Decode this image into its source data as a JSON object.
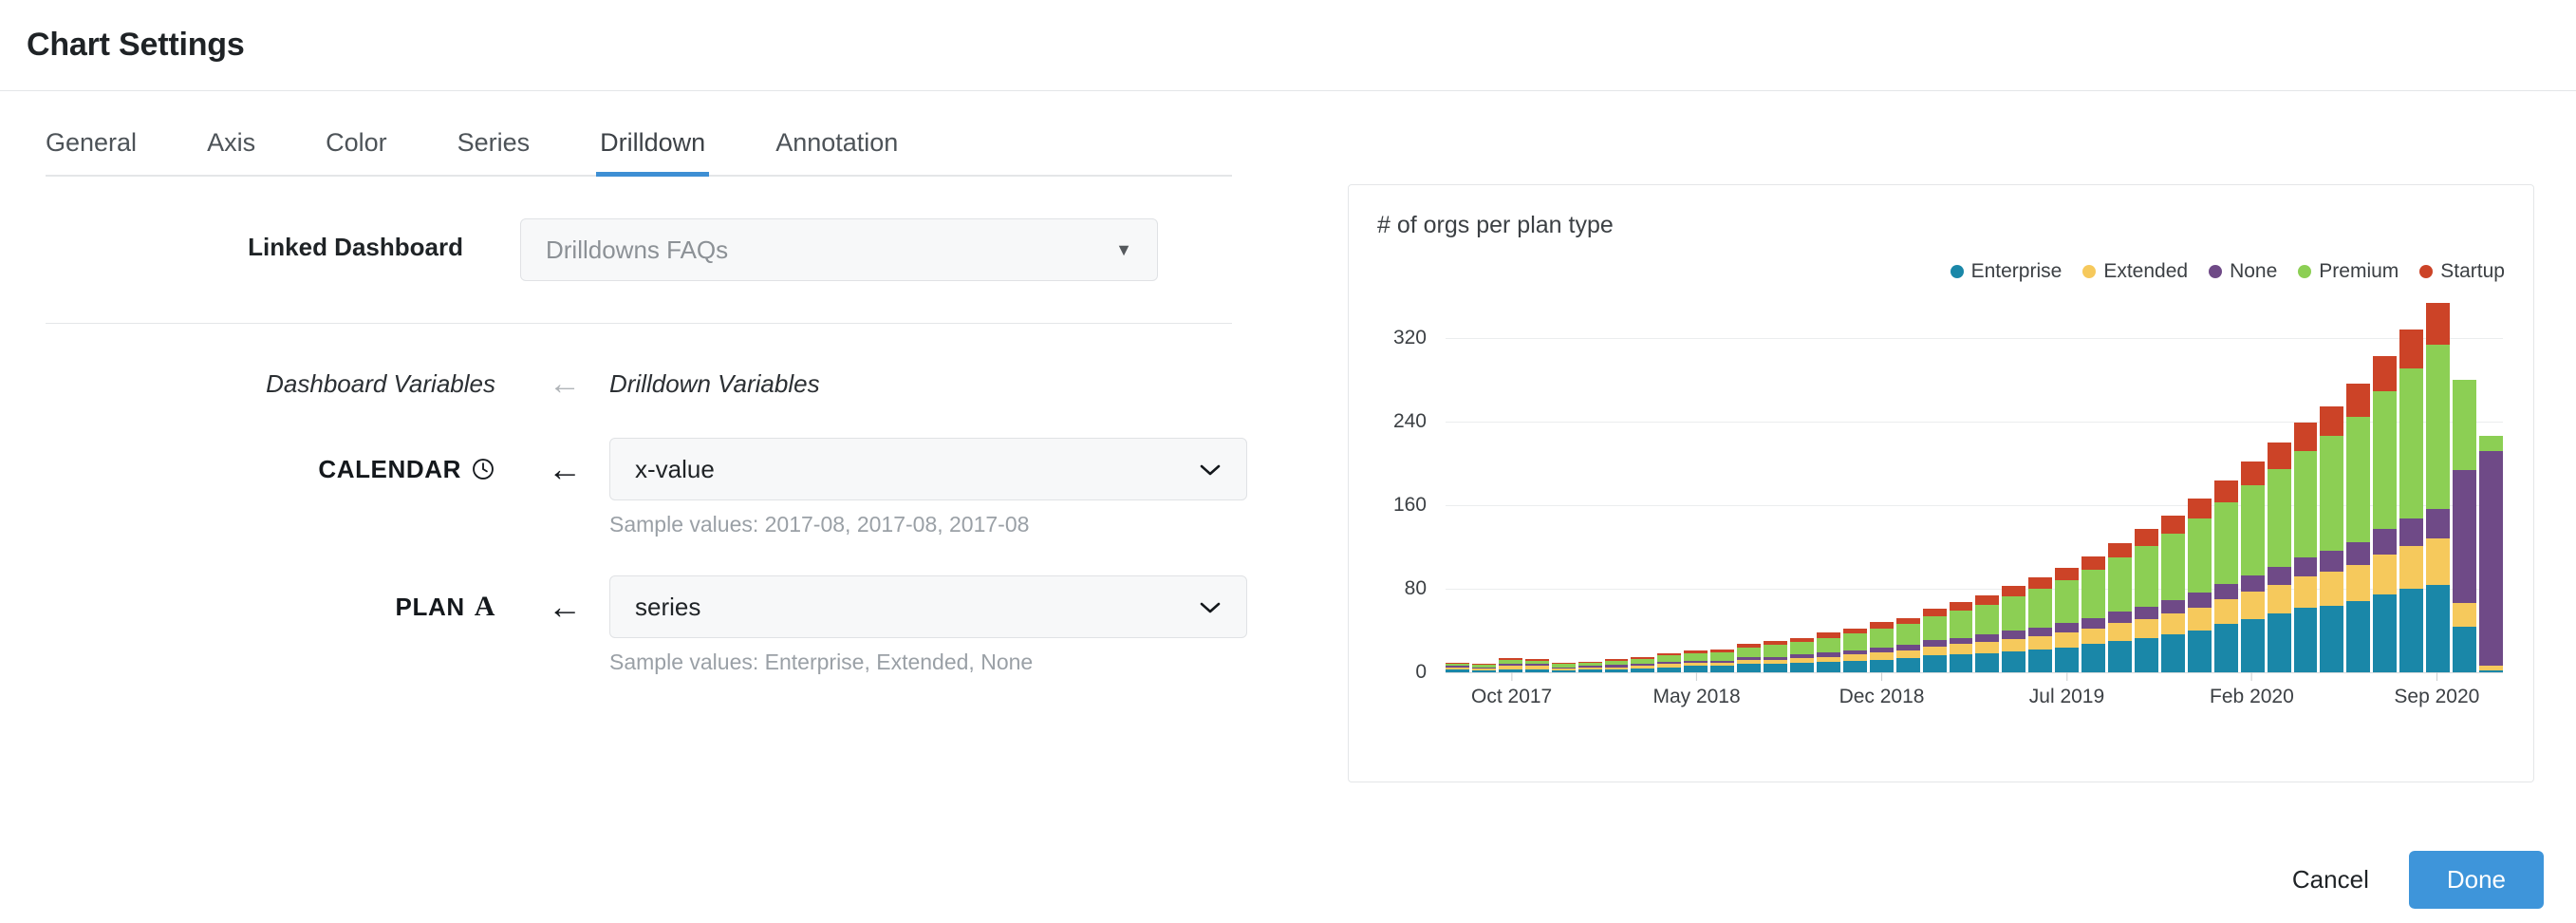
{
  "header": {
    "title": "Chart Settings"
  },
  "tabs": [
    {
      "label": "General",
      "active": false
    },
    {
      "label": "Axis",
      "active": false
    },
    {
      "label": "Color",
      "active": false
    },
    {
      "label": "Series",
      "active": false
    },
    {
      "label": "Drilldown",
      "active": true
    },
    {
      "label": "Annotation",
      "active": false
    }
  ],
  "linked_dashboard": {
    "label": "Linked Dashboard",
    "value": "Drilldowns FAQs",
    "caret": "▼"
  },
  "variables": {
    "left_heading": "Dashboard Variables",
    "right_heading": "Drilldown Variables",
    "head_arrow": "←",
    "rows": [
      {
        "name": "CALENDAR",
        "type_icon": "clock-icon",
        "arrow": "←",
        "value": "x-value",
        "sample": "Sample values: 2017-08, 2017-08, 2017-08",
        "caret": "⌄"
      },
      {
        "name": "PLAN",
        "type_icon": "text-type-icon",
        "type_glyph": "A",
        "arrow": "←",
        "value": "series",
        "sample": "Sample values: Enterprise, Extended, None",
        "caret": "⌄"
      }
    ]
  },
  "footer": {
    "cancel_label": "Cancel",
    "done_label": "Done",
    "done_color": "#3e95da"
  },
  "chart_data": {
    "type": "bar",
    "stacked": true,
    "title": "# of orgs per plan type",
    "xlabel": "",
    "ylabel": "",
    "ylim": [
      0,
      360
    ],
    "yticks": [
      0,
      80,
      160,
      240,
      320
    ],
    "grid": true,
    "legend_position": "top-right",
    "colors": {
      "Enterprise": "#1a87a8",
      "Extended": "#f6c95c",
      "None": "#6f4a87",
      "Premium": "#8ccf54",
      "Startup": "#cc4327"
    },
    "legend": [
      "Enterprise",
      "Extended",
      "None",
      "Premium",
      "Startup"
    ],
    "categories": [
      "2017-08",
      "2017-09",
      "2017-10",
      "2017-11",
      "2017-12",
      "2018-01",
      "2018-02",
      "2018-03",
      "2018-04",
      "2018-05",
      "2018-06",
      "2018-07",
      "2018-08",
      "2018-09",
      "2018-10",
      "2018-11",
      "2018-12",
      "2019-01",
      "2019-02",
      "2019-03",
      "2019-04",
      "2019-05",
      "2019-06",
      "2019-07",
      "2019-08",
      "2019-09",
      "2019-10",
      "2019-11",
      "2019-12",
      "2020-01",
      "2020-02",
      "2020-03",
      "2020-04",
      "2020-05",
      "2020-06",
      "2020-07",
      "2020-08",
      "2020-09",
      "2020-10",
      "2020-11"
    ],
    "xtick_labels": [
      "Oct 2017",
      "May 2018",
      "Dec 2018",
      "Jul 2019",
      "Feb 2020",
      "Sep 2020"
    ],
    "xtick_indices": [
      2,
      9,
      16,
      23,
      30,
      37
    ],
    "series": [
      {
        "name": "Enterprise",
        "values": [
          3,
          2,
          3,
          3,
          2,
          3,
          3,
          4,
          5,
          6,
          6,
          8,
          8,
          9,
          10,
          11,
          12,
          14,
          16,
          17,
          18,
          20,
          22,
          24,
          27,
          30,
          33,
          36,
          40,
          46,
          51,
          56,
          62,
          64,
          68,
          75,
          80,
          84,
          44,
          2
        ]
      },
      {
        "name": "Extended",
        "values": [
          2,
          2,
          3,
          3,
          2,
          2,
          2,
          2,
          3,
          3,
          3,
          4,
          4,
          5,
          5,
          6,
          7,
          7,
          9,
          10,
          11,
          12,
          13,
          14,
          15,
          17,
          18,
          20,
          22,
          24,
          26,
          28,
          30,
          32,
          35,
          38,
          41,
          44,
          22,
          4
        ]
      },
      {
        "name": "None",
        "values": [
          1,
          1,
          2,
          2,
          1,
          1,
          2,
          2,
          2,
          2,
          2,
          3,
          3,
          3,
          4,
          4,
          5,
          5,
          6,
          6,
          7,
          8,
          8,
          9,
          10,
          11,
          12,
          13,
          14,
          15,
          16,
          17,
          18,
          20,
          22,
          24,
          26,
          28,
          128,
          206
        ]
      },
      {
        "name": "Premium",
        "values": [
          2,
          2,
          4,
          3,
          3,
          3,
          4,
          5,
          6,
          7,
          8,
          9,
          11,
          12,
          14,
          16,
          18,
          20,
          23,
          26,
          29,
          33,
          37,
          41,
          46,
          52,
          58,
          64,
          71,
          78,
          86,
          94,
          102,
          110,
          120,
          132,
          144,
          158,
          86,
          14
        ]
      },
      {
        "name": "Startup",
        "values": [
          1,
          1,
          2,
          2,
          1,
          1,
          2,
          2,
          2,
          3,
          3,
          3,
          4,
          4,
          5,
          5,
          6,
          6,
          7,
          8,
          9,
          10,
          11,
          12,
          13,
          14,
          16,
          17,
          19,
          21,
          23,
          25,
          27,
          29,
          31,
          34,
          37,
          40,
          0,
          0
        ]
      }
    ]
  }
}
